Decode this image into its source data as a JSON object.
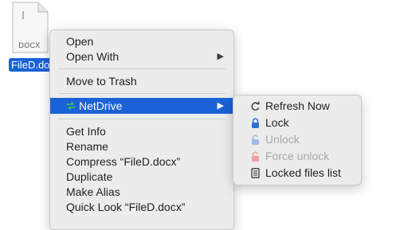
{
  "file": {
    "name": "FileD.docx",
    "type_label": "DOCX"
  },
  "context_menu": {
    "items": [
      {
        "label": "Open"
      },
      {
        "label": "Open With"
      },
      {
        "label": "Move to Trash"
      },
      {
        "label": "NetDrive"
      },
      {
        "label": "Get Info"
      },
      {
        "label": "Rename"
      },
      {
        "label": "Compress “FileD.docx”"
      },
      {
        "label": "Duplicate"
      },
      {
        "label": "Make Alias"
      },
      {
        "label": "Quick Look “FileD.docx”"
      }
    ],
    "submenu_arrow": "▶"
  },
  "netdrive_submenu": {
    "items": [
      {
        "label": "Refresh Now",
        "icon": "refresh-icon",
        "enabled": true
      },
      {
        "label": "Lock",
        "icon": "lock-icon",
        "enabled": true
      },
      {
        "label": "Unlock",
        "icon": "unlock-icon",
        "enabled": false
      },
      {
        "label": "Force unlock",
        "icon": "force-unlock-icon",
        "enabled": false
      },
      {
        "label": "Locked files list",
        "icon": "list-icon",
        "enabled": true
      }
    ]
  },
  "colors": {
    "selection": "#1a62d6",
    "menu_bg": "#ececec",
    "lock_blue": "#2f6fd6",
    "force_red": "#e05a5a",
    "netdrive_green": "#3dbb6a"
  }
}
